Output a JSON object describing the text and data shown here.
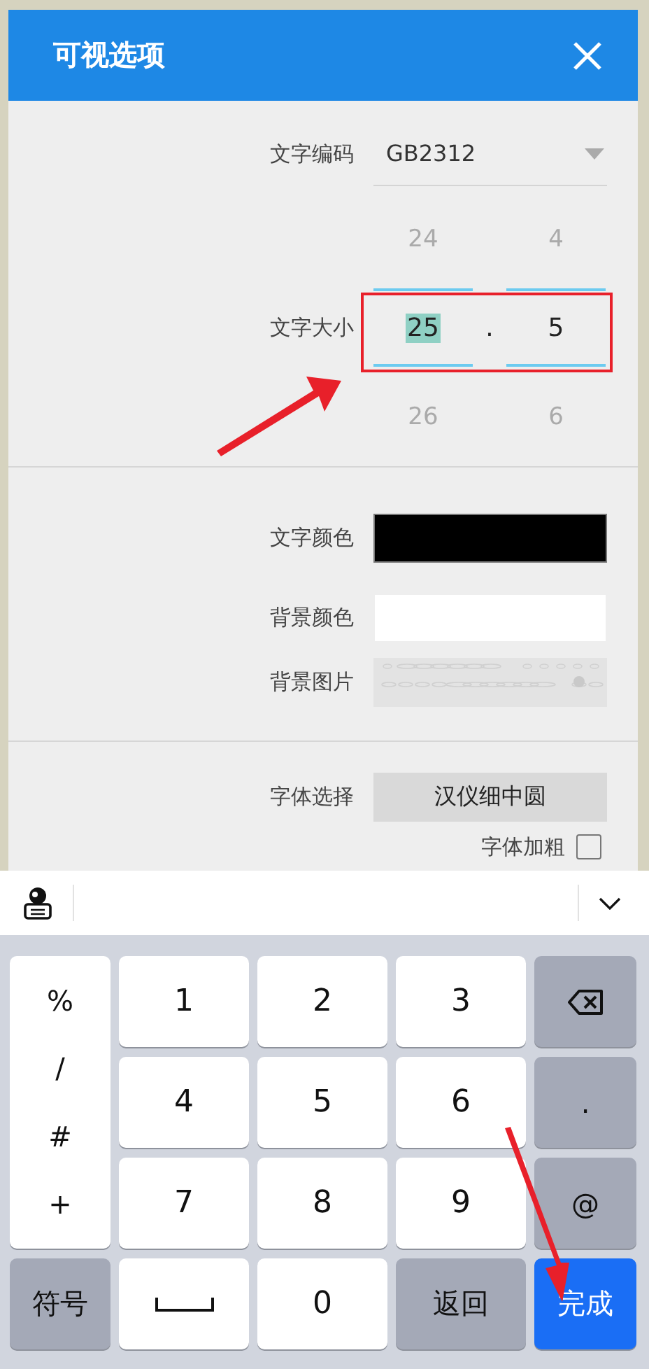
{
  "dialog": {
    "title": "可视选项",
    "encoding": {
      "label": "文字编码",
      "value": "GB2312"
    },
    "text_size": {
      "label": "文字大小",
      "separator": ".",
      "above": [
        "24",
        "4"
      ],
      "value": [
        {
          "text": "25",
          "highlighted": true
        },
        {
          "text": "5",
          "highlighted": false
        }
      ],
      "below": [
        "26",
        "6"
      ]
    },
    "swatches": [
      {
        "label": "文字颜色",
        "color": "#000000"
      },
      {
        "label": "背景颜色",
        "color": "#ffffff"
      }
    ],
    "background_image": {
      "label": "背景图片",
      "kind": "picture"
    },
    "font": {
      "label": "字体选择",
      "value": "汉仪细中圆"
    },
    "bold": {
      "label": "字体加粗",
      "checked": false
    }
  },
  "keyboard": {
    "side_keys": [
      "%",
      "/",
      "#",
      "+"
    ],
    "keys": [
      {
        "kind": "char",
        "label": "1"
      },
      {
        "kind": "char",
        "label": "2"
      },
      {
        "kind": "char",
        "label": "3"
      },
      {
        "kind": "backspace"
      },
      {
        "kind": "char",
        "label": "4"
      },
      {
        "kind": "char",
        "label": "5"
      },
      {
        "kind": "char",
        "label": "6"
      },
      {
        "kind": "function",
        "label": "."
      },
      {
        "kind": "char",
        "label": "7"
      },
      {
        "kind": "char",
        "label": "8"
      },
      {
        "kind": "char",
        "label": "9"
      },
      {
        "kind": "function",
        "label": "@"
      },
      {
        "kind": "function",
        "label": "符号"
      },
      {
        "kind": "space"
      },
      {
        "kind": "char",
        "label": "0"
      },
      {
        "kind": "function",
        "label": "返回"
      },
      {
        "kind": "action",
        "label": "完成"
      }
    ]
  }
}
